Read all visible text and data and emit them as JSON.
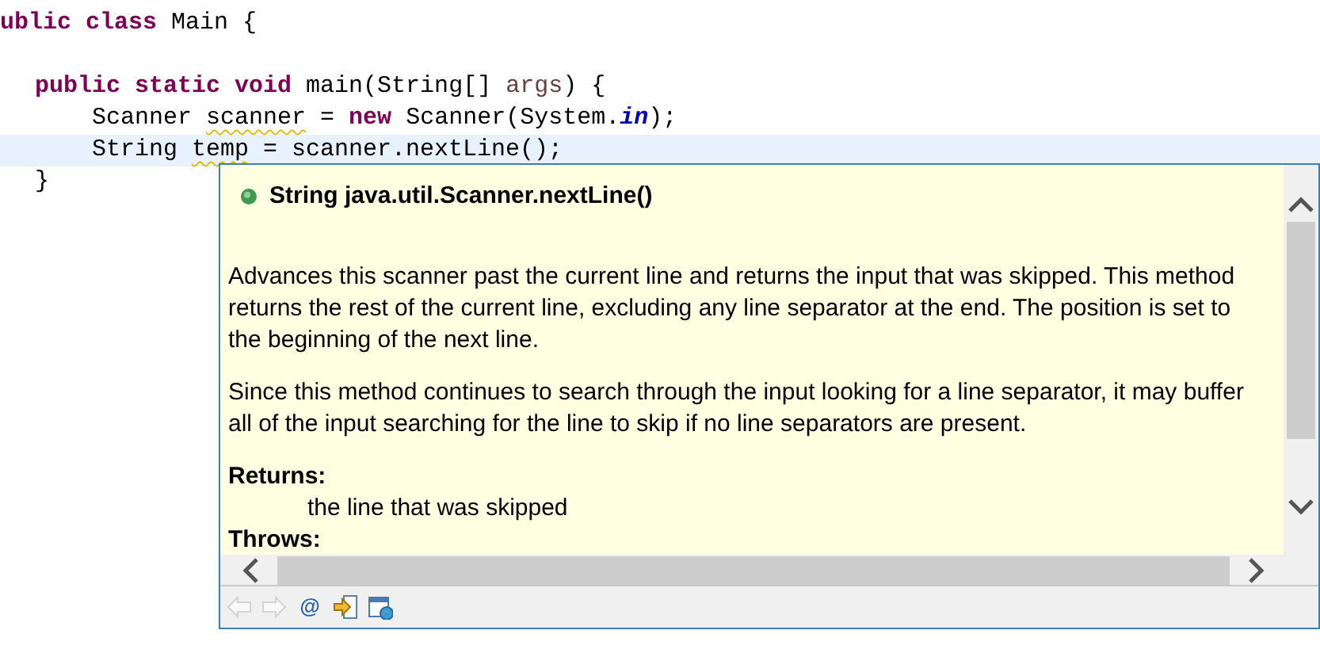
{
  "editor": {
    "lines": [
      {
        "tokens": [
          {
            "text": "ublic",
            "kind": "keyword"
          },
          {
            "text": " class",
            "kind": "keyword"
          },
          {
            "text": " Main {",
            "kind": "text"
          }
        ],
        "children": [
          {
            "tokens": [
              {
                "text": "public",
                "kind": "keyword"
              },
              {
                "text": " static",
                "kind": "keyword"
              },
              {
                "text": " void",
                "kind": "keyword"
              },
              {
                "text": " main(String[] ",
                "kind": "text"
              },
              {
                "text": "args",
                "kind": "parameter"
              },
              {
                "text": ") {",
                "kind": "text"
              }
            ],
            "children": [
              {
                "highlighted": false,
                "tokens": [
                  {
                    "text": "Scanner ",
                    "kind": "text"
                  },
                  {
                    "text": "scanner",
                    "kind": "warning"
                  },
                  {
                    "text": " = ",
                    "kind": "text"
                  },
                  {
                    "text": "new",
                    "kind": "keyword"
                  },
                  {
                    "text": " Scanner(System.",
                    "kind": "text"
                  },
                  {
                    "text": "in",
                    "kind": "static"
                  },
                  {
                    "text": ");",
                    "kind": "text"
                  }
                ]
              },
              {
                "highlighted": true,
                "tokens": [
                  {
                    "text": "String ",
                    "kind": "text"
                  },
                  {
                    "text": "temp",
                    "kind": "warning"
                  },
                  {
                    "text": " = scanner.nextLine();",
                    "kind": "text"
                  }
                ]
              }
            ]
          },
          {
            "tokens": [
              {
                "text": "}",
                "kind": "text"
              }
            ]
          }
        ]
      }
    ]
  },
  "hover": {
    "signature": "String java.util.Scanner.nextLine()",
    "paragraphs": [
      "Advances this scanner past the current line and returns the input that was skipped. This method returns the rest of the current line, excluding any line separator at the end. The position is set to the beginning of the next line.",
      "Since this method continues to search through the input looking for a line separator, it may buffer all of the input searching for the line to skip if no line separators are present."
    ],
    "returns_heading": "Returns:",
    "returns": "the line that was skipped",
    "throws_heading": "Throws:",
    "toolbar": [
      {
        "kind": "back",
        "disabled": true
      },
      {
        "kind": "forward",
        "disabled": true
      },
      {
        "kind": "javadoc",
        "label": "@"
      },
      {
        "kind": "declaration"
      },
      {
        "kind": "browser"
      }
    ]
  }
}
